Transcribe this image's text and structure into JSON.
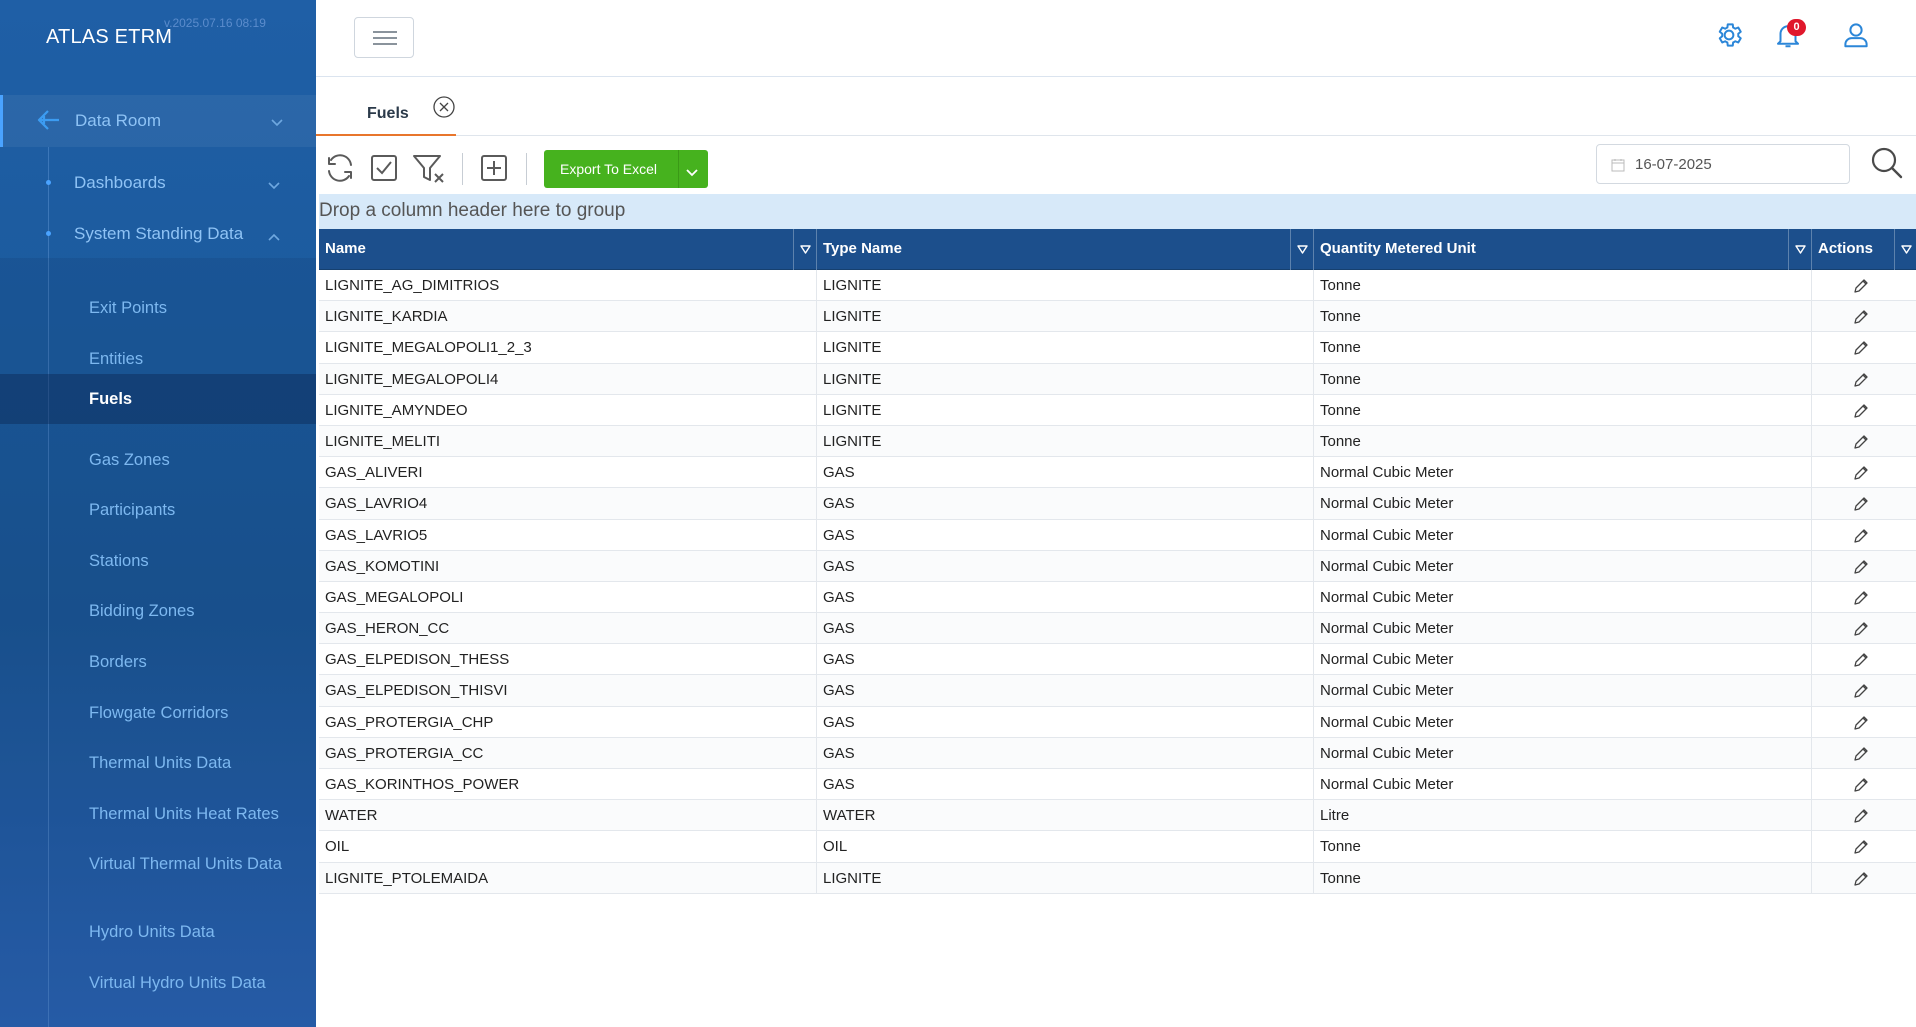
{
  "sidebar": {
    "brand": "ATLAS ETRM",
    "version": "v.2025.07.16 08:19",
    "top_item": "Data Room",
    "groups": [
      {
        "label": "Dashboards"
      },
      {
        "label": "System Standing Data"
      }
    ],
    "items": [
      {
        "label": "Exit Points"
      },
      {
        "label": "Entities"
      },
      {
        "label": "Fuels",
        "active": true
      },
      {
        "label": "Gas Zones"
      },
      {
        "label": "Participants"
      },
      {
        "label": "Stations"
      },
      {
        "label": "Bidding Zones"
      },
      {
        "label": "Borders"
      },
      {
        "label": "Flowgate Corridors"
      },
      {
        "label": "Thermal Units Data"
      },
      {
        "label": "Thermal Units Heat Rates"
      },
      {
        "label": "Virtual Thermal Units Data"
      },
      {
        "label": "Hydro Units Data"
      },
      {
        "label": "Virtual Hydro Units Data"
      }
    ]
  },
  "header": {
    "notifications_count": "0",
    "icons": [
      "gear-icon",
      "bell-icon",
      "user-icon"
    ]
  },
  "tabs": [
    {
      "label": "Fuels"
    }
  ],
  "toolbar": {
    "export_label": "Export To Excel",
    "date_value": "16-07-2025"
  },
  "grid": {
    "group_hint": "Drop a column header here to group",
    "columns": [
      "Name",
      "Type Name",
      "Quantity Metered Unit",
      "Actions"
    ],
    "rows": [
      [
        "LIGNITE_AG_DIMITRIOS",
        "LIGNITE",
        "Tonne"
      ],
      [
        "LIGNITE_KARDIA",
        "LIGNITE",
        "Tonne"
      ],
      [
        "LIGNITE_MEGALOPOLI1_2_3",
        "LIGNITE",
        "Tonne"
      ],
      [
        "LIGNITE_MEGALOPOLI4",
        "LIGNITE",
        "Tonne"
      ],
      [
        "LIGNITE_AMYNDEO",
        "LIGNITE",
        "Tonne"
      ],
      [
        "LIGNITE_MELITI",
        "LIGNITE",
        "Tonne"
      ],
      [
        "GAS_ALIVERI",
        "GAS",
        "Normal Cubic Meter"
      ],
      [
        "GAS_LAVRIO4",
        "GAS",
        "Normal Cubic Meter"
      ],
      [
        "GAS_LAVRIO5",
        "GAS",
        "Normal Cubic Meter"
      ],
      [
        "GAS_KOMOTINI",
        "GAS",
        "Normal Cubic Meter"
      ],
      [
        "GAS_MEGALOPOLI",
        "GAS",
        "Normal Cubic Meter"
      ],
      [
        "GAS_HERON_CC",
        "GAS",
        "Normal Cubic Meter"
      ],
      [
        "GAS_ELPEDISON_THESS",
        "GAS",
        "Normal Cubic Meter"
      ],
      [
        "GAS_ELPEDISON_THISVI",
        "GAS",
        "Normal Cubic Meter"
      ],
      [
        "GAS_PROTERGIA_CHP",
        "GAS",
        "Normal Cubic Meter"
      ],
      [
        "GAS_PROTERGIA_CC",
        "GAS",
        "Normal Cubic Meter"
      ],
      [
        "GAS_KORINTHOS_POWER",
        "GAS",
        "Normal Cubic Meter"
      ],
      [
        "WATER",
        "WATER",
        "Litre"
      ],
      [
        "OIL",
        "OIL",
        "Tonne"
      ],
      [
        "LIGNITE_PTOLEMAIDA",
        "LIGNITE",
        "Tonne"
      ]
    ]
  },
  "colors": {
    "sidebar": "#1c5b9e",
    "grid_header": "#1c4f8c",
    "export_button": "#46b21e",
    "tab_underline": "#e8762c",
    "badge": "#e0182c"
  }
}
